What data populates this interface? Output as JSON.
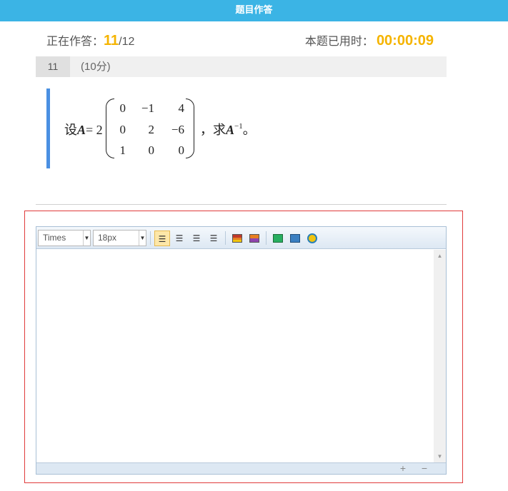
{
  "header": {
    "title": "题目作答"
  },
  "progress": {
    "label": "正在作答：",
    "current": "11",
    "total": "/12"
  },
  "timer": {
    "label": "本题已用时：",
    "value": "00:00:09"
  },
  "question": {
    "number": "11",
    "score": "(10分)",
    "prefix": "设",
    "matrix_var": "A",
    "equals": "= 2",
    "matrix": [
      [
        "0",
        "−1",
        "4"
      ],
      [
        "0",
        "2",
        "−6"
      ],
      [
        "1",
        "0",
        "0"
      ]
    ],
    "suffix_text": "，求",
    "inverse_var": "A",
    "inverse_exp": "−1",
    "end_punct": "。"
  },
  "editor": {
    "font_family": "Times",
    "font_size": "18px",
    "toolbar_icons": [
      "align-left-icon",
      "align-center-icon",
      "align-right-icon",
      "align-justify-icon",
      "insert-image-icon",
      "image-gallery-icon",
      "formula-icon",
      "table-icon",
      "record-icon"
    ],
    "scroll_up": "▲",
    "scroll_down": "▼",
    "expand_label": "+",
    "collapse_label": "−"
  },
  "colors": {
    "topbar": "#3bb4e5",
    "accent": "#f5b400",
    "question_bar": "#4a90e2",
    "answer_border": "#e03b3b"
  }
}
